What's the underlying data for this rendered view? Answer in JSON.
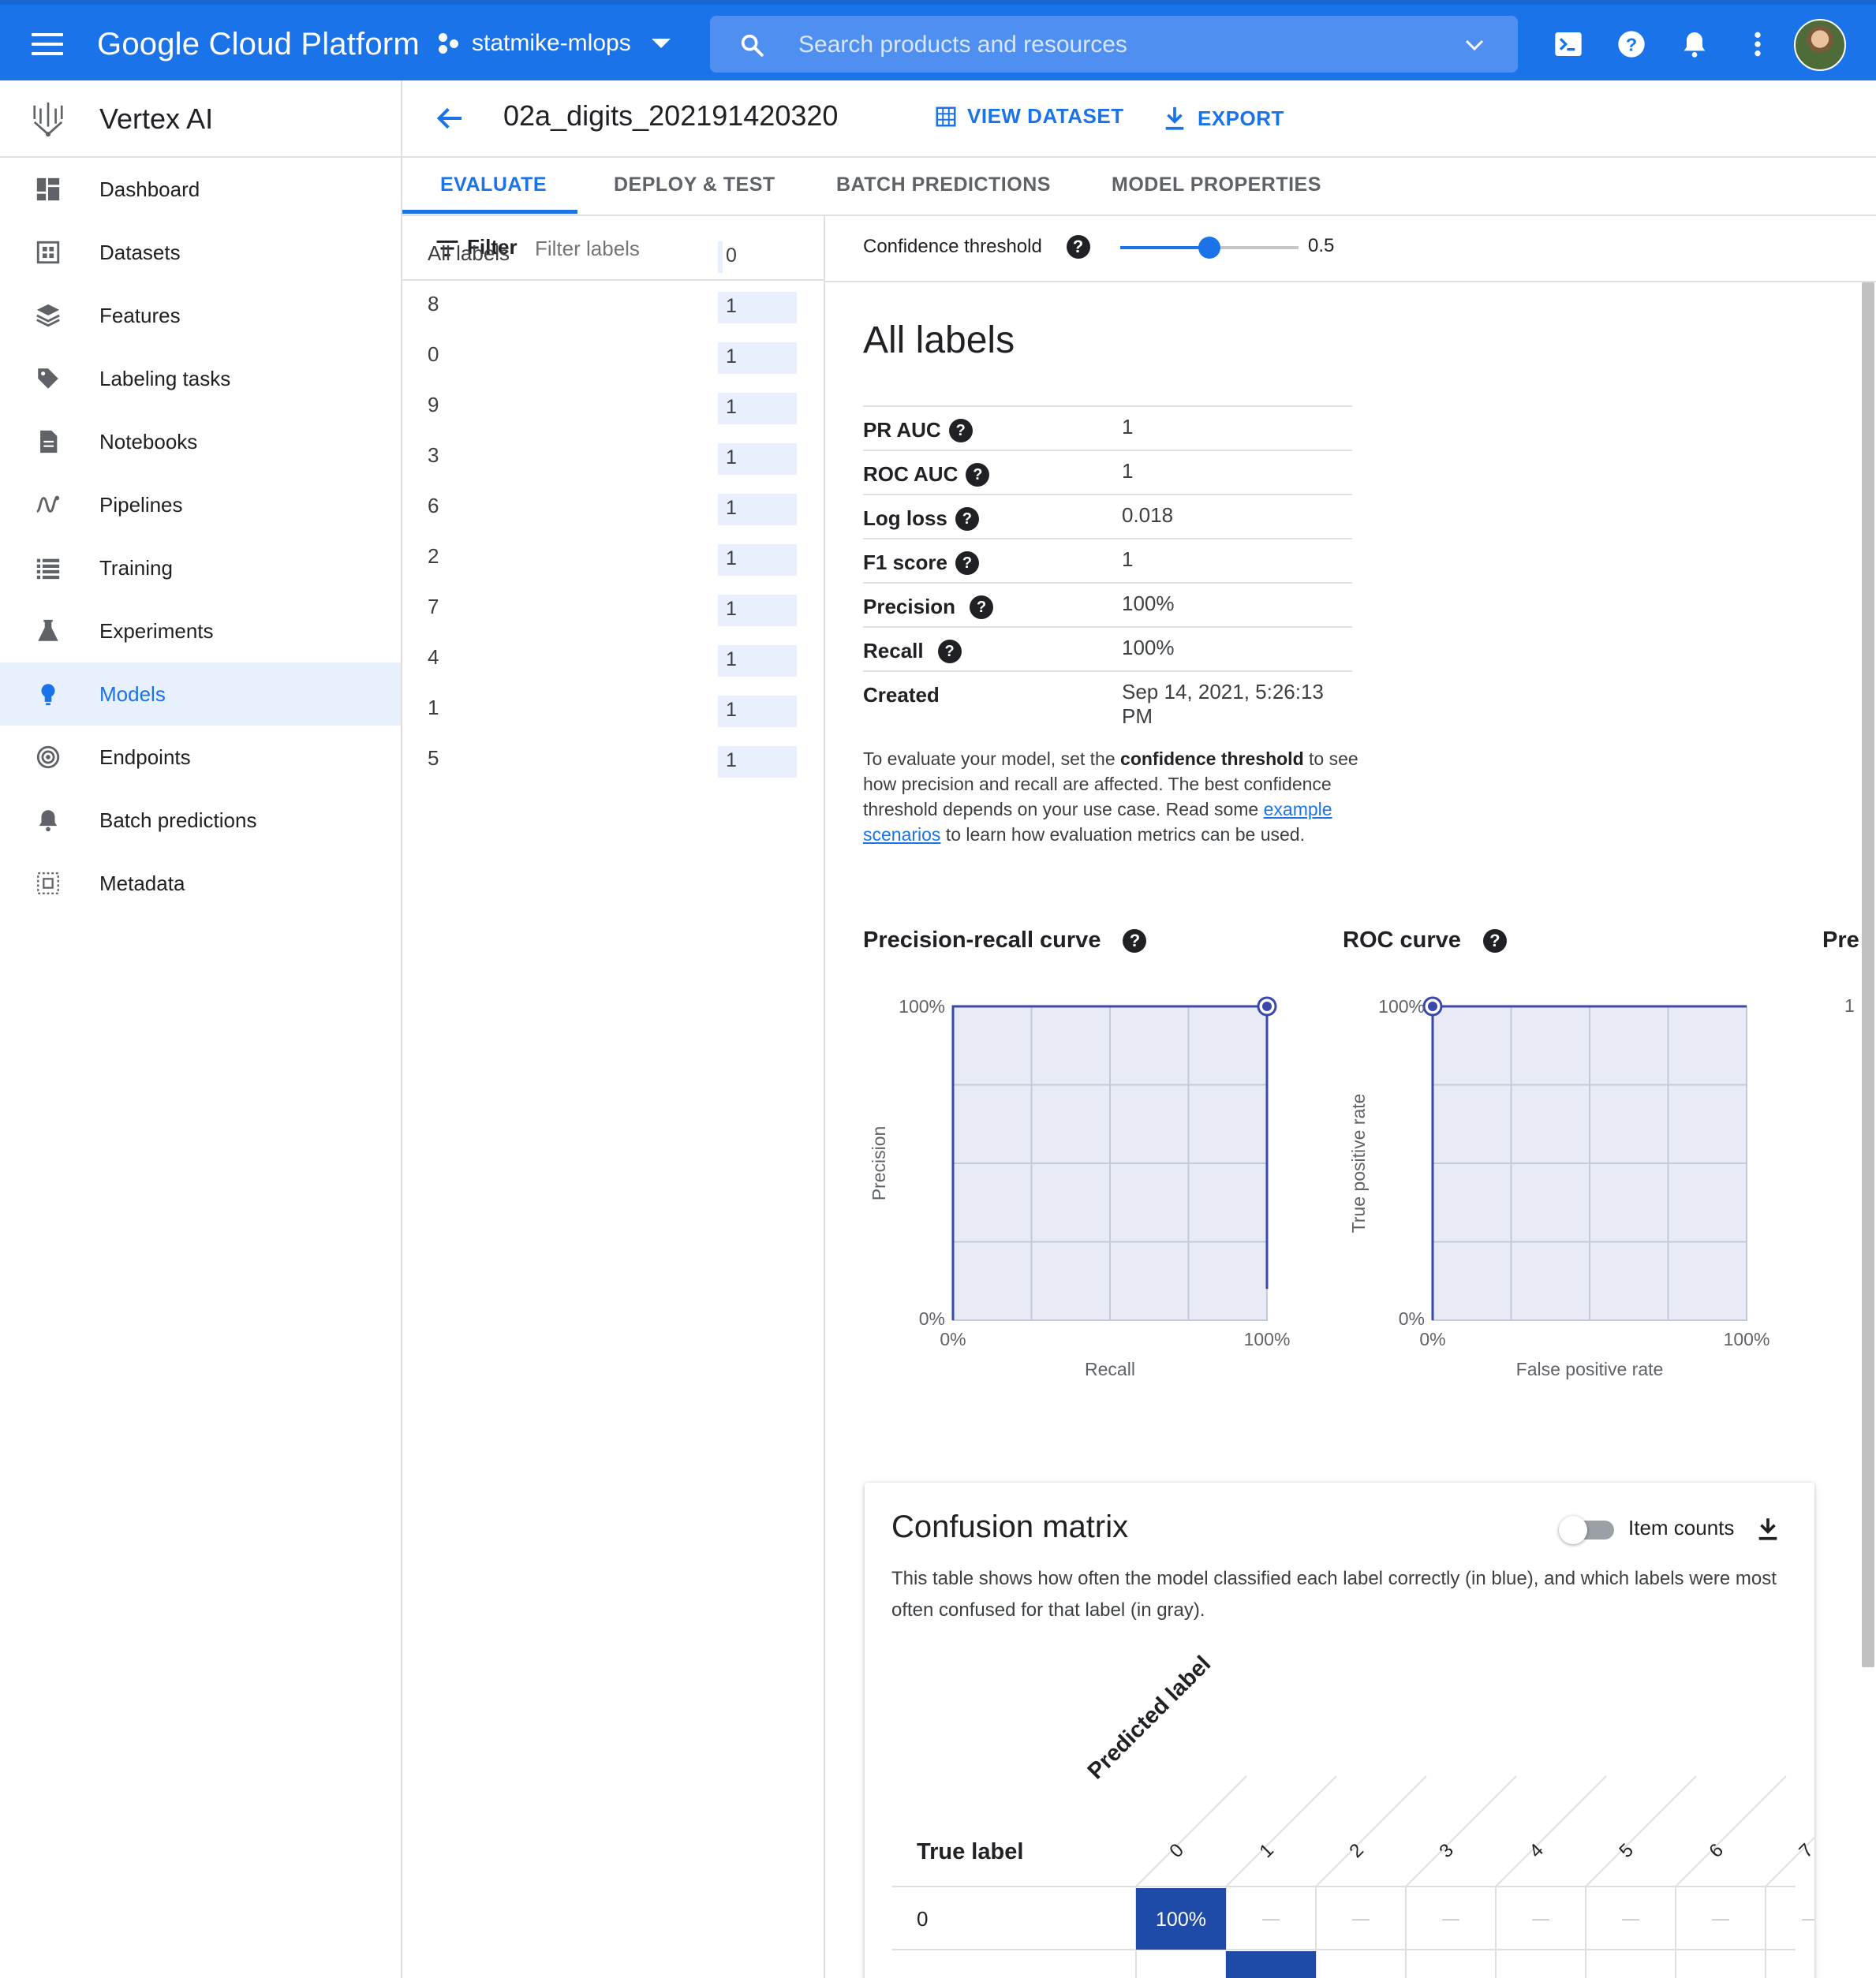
{
  "topbar": {
    "brand": "Google Cloud Platform",
    "project": "statmike-mlops",
    "search_placeholder": "Search products and resources"
  },
  "product": {
    "name": "Vertex AI"
  },
  "nav": [
    {
      "label": "Dashboard",
      "icon": "dashboard-icon"
    },
    {
      "label": "Datasets",
      "icon": "datasets-icon"
    },
    {
      "label": "Features",
      "icon": "features-icon"
    },
    {
      "label": "Labeling tasks",
      "icon": "label-tag-icon"
    },
    {
      "label": "Notebooks",
      "icon": "notebook-icon"
    },
    {
      "label": "Pipelines",
      "icon": "pipelines-icon"
    },
    {
      "label": "Training",
      "icon": "training-list-icon"
    },
    {
      "label": "Experiments",
      "icon": "flask-icon"
    },
    {
      "label": "Models",
      "icon": "lightbulb-icon",
      "active": true
    },
    {
      "label": "Endpoints",
      "icon": "endpoints-icon"
    },
    {
      "label": "Batch predictions",
      "icon": "bell-icon"
    },
    {
      "label": "Metadata",
      "icon": "metadata-icon"
    }
  ],
  "header": {
    "model_name": "02a_digits_202191420320",
    "view_dataset": "VIEW DATASET",
    "export": "EXPORT"
  },
  "tabs": [
    "EVALUATE",
    "DEPLOY & TEST",
    "BATCH PREDICTIONS",
    "MODEL PROPERTIES"
  ],
  "filter": {
    "label": "Filter",
    "placeholder": "Filter labels"
  },
  "labels": [
    {
      "name": "All labels",
      "value": "0"
    },
    {
      "name": "8",
      "value": "1"
    },
    {
      "name": "0",
      "value": "1"
    },
    {
      "name": "9",
      "value": "1"
    },
    {
      "name": "3",
      "value": "1"
    },
    {
      "name": "6",
      "value": "1"
    },
    {
      "name": "2",
      "value": "1"
    },
    {
      "name": "7",
      "value": "1"
    },
    {
      "name": "4",
      "value": "1"
    },
    {
      "name": "1",
      "value": "1"
    },
    {
      "name": "5",
      "value": "1"
    }
  ],
  "threshold": {
    "label": "Confidence threshold",
    "value": "0.5",
    "fraction": 0.5
  },
  "summary": {
    "title": "All labels",
    "metrics": [
      {
        "key": "PR AUC",
        "value": "1",
        "help": true
      },
      {
        "key": "ROC AUC",
        "value": "1",
        "help": true
      },
      {
        "key": "Log loss",
        "value": "0.018",
        "help": true
      },
      {
        "key": "F1 score",
        "value": "1",
        "help": true
      },
      {
        "key": "Precision",
        "value": "100%",
        "help": true
      },
      {
        "key": "Recall",
        "value": "100%",
        "help": true
      },
      {
        "key": "Created",
        "value": "Sep 14, 2021, 5:26:13 PM",
        "help": false
      }
    ],
    "explain_1": "To evaluate your model, set the ",
    "explain_bold": "confidence threshold",
    "explain_2": " to see how precision and recall are affected. The best confidence threshold depends on your use case. Read some ",
    "explain_link": "example scenarios",
    "explain_3": " to learn how evaluation metrics can be used."
  },
  "curves": {
    "pr_title": "Precision-recall curve",
    "roc_title": "ROC curve",
    "third_title_partial": "Pre",
    "third_tick_partial": "1"
  },
  "chart_data": [
    {
      "type": "line",
      "title": "Precision-recall curve",
      "xlabel": "Recall",
      "ylabel": "Precision",
      "x_ticks": [
        "0%",
        "100%"
      ],
      "y_ticks": [
        "0%",
        "100%"
      ],
      "xlim": [
        0,
        1
      ],
      "ylim": [
        0,
        1
      ],
      "series": [
        {
          "x": [
            0,
            0,
            1,
            1
          ],
          "y": [
            0,
            1,
            1,
            0.1
          ]
        }
      ],
      "marker": {
        "x": 1,
        "y": 1
      }
    },
    {
      "type": "line",
      "title": "ROC curve",
      "xlabel": "False positive rate",
      "ylabel": "True positive rate",
      "x_ticks": [
        "0%",
        "100%"
      ],
      "y_ticks": [
        "0%",
        "100%"
      ],
      "xlim": [
        0,
        1
      ],
      "ylim": [
        0,
        1
      ],
      "series": [
        {
          "x": [
            0,
            0,
            1
          ],
          "y": [
            0,
            1,
            1
          ]
        }
      ],
      "marker": {
        "x": 0,
        "y": 1
      }
    }
  ],
  "confusion": {
    "title": "Confusion matrix",
    "toggle_label": "Item counts",
    "description": "This table shows how often the model classified each label correctly (in blue), and which labels were most often confused for that label (in gray).",
    "true_label": "True label",
    "predicted_label": "Predicted label",
    "columns": [
      "0",
      "1",
      "2",
      "3",
      "4",
      "5",
      "6",
      "7"
    ],
    "rows": [
      {
        "label": "0",
        "cells": [
          "100%",
          "—",
          "—",
          "—",
          "—",
          "—",
          "—",
          "—"
        ]
      }
    ],
    "colors": {
      "diag": "#1e4aa8",
      "empty": "#bdc1c6"
    }
  },
  "colors": {
    "brand": "#1a73e8",
    "plot_fill": "#e8eaf6",
    "plot_line": "#3949ab"
  }
}
